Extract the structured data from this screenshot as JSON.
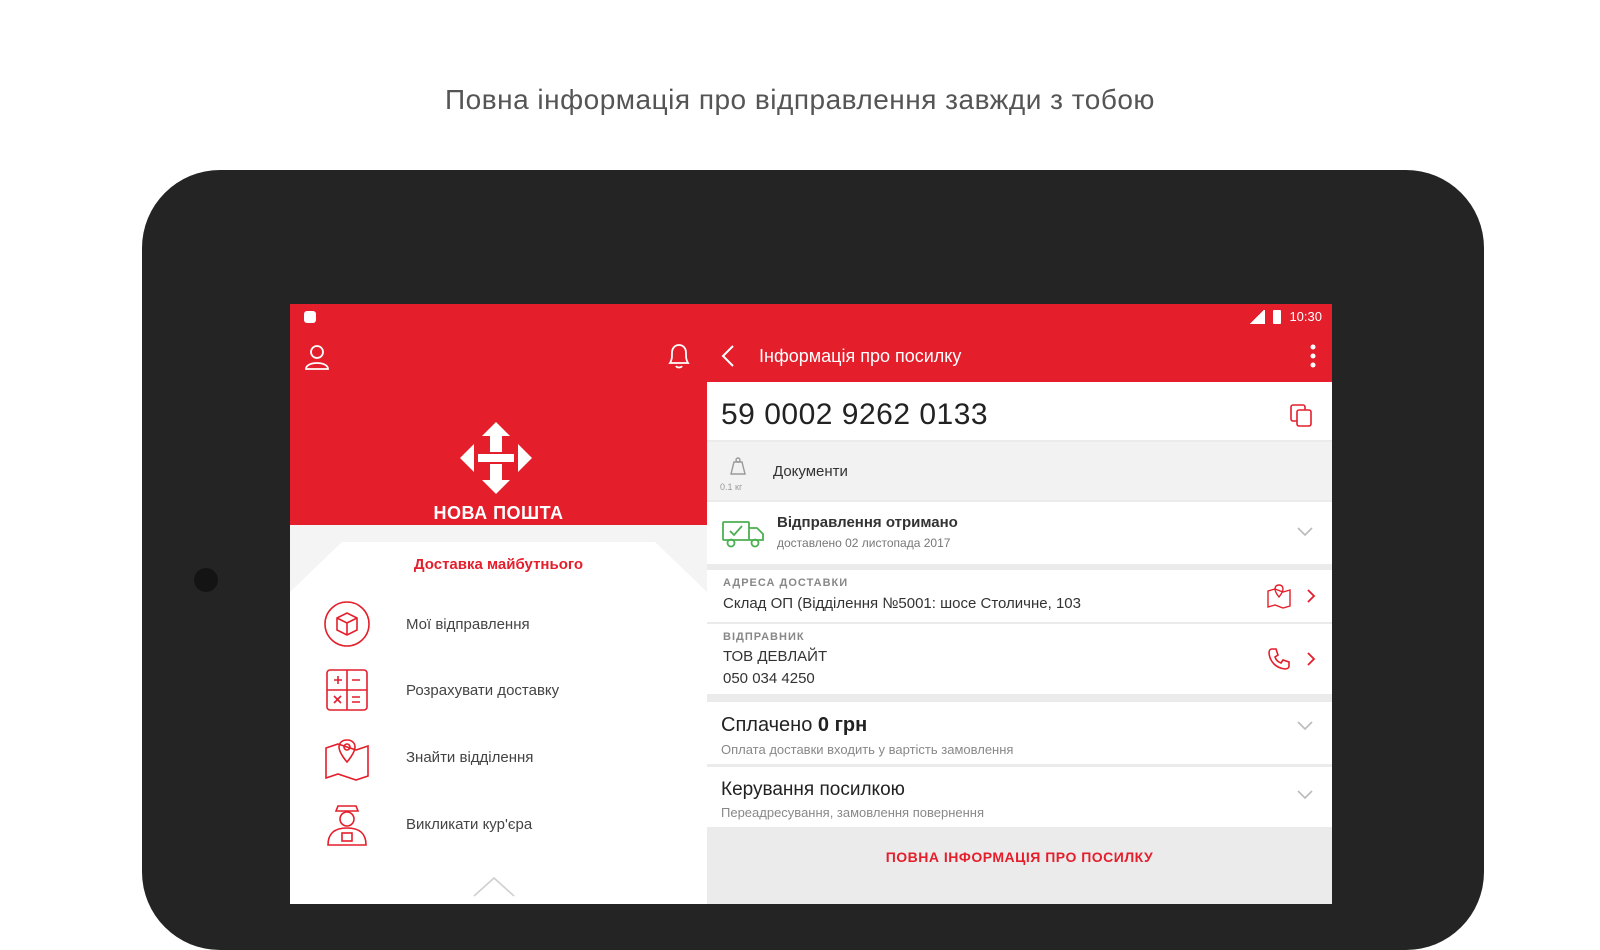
{
  "headline": "Повна інформація про відправлення завжди з тобою",
  "status_bar": {
    "time": "10:30"
  },
  "brand": {
    "name": "НОВА ПОШТА",
    "tagline": "Доставка майбутнього"
  },
  "menu": [
    {
      "label": "Мої відправлення",
      "icon": "box-icon"
    },
    {
      "label": "Розрахувати доставку",
      "icon": "calculator-icon"
    },
    {
      "label": "Знайти відділення",
      "icon": "map-pin-icon"
    },
    {
      "label": "Викликати кур'єра",
      "icon": "courier-icon"
    }
  ],
  "detail": {
    "title": "Інформація про посилку",
    "tracking_number": "59 0002 9262 0133",
    "weight": "0.1 кг",
    "cargo_type": "Документи",
    "status_title": "Відправлення отримано",
    "status_sub": "доставлено 02 листопада 2017",
    "address_label": "АДРЕСА ДОСТАВКИ",
    "address_value": "Склад ОП (Відділення №5001: шосе Столичне, 103",
    "sender_label": "ВІДПРАВНИК",
    "sender_name": "ТОВ ДЕВЛАЙТ",
    "sender_phone": "050 034 4250",
    "paid_prefix": "Сплачено",
    "paid_amount": "0 грн",
    "paid_sub": "Оплата доставки входить у вартість замовлення",
    "manage_title": "Керування посилкою",
    "manage_sub": "Переадресування, замовлення повернення",
    "full_info_button": "ПОВНА ІНФОРМАЦІЯ ПРО ПОСИЛКУ"
  },
  "colors": {
    "brand_red": "#e41e2b",
    "truck_green": "#4caf50",
    "device": "#242424"
  }
}
